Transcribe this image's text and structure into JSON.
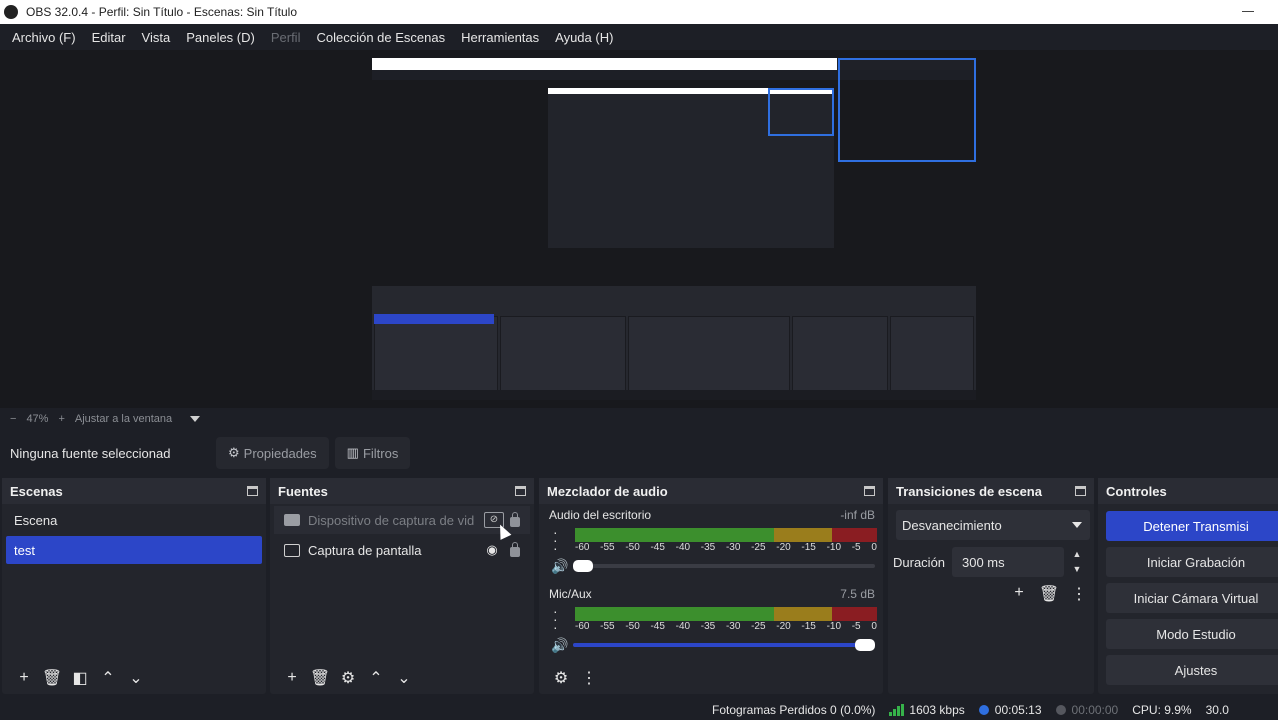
{
  "window": {
    "title": "OBS 32.0.4 - Perfil: Sin Título - Escenas: Sin Título"
  },
  "menu": [
    "Archivo (F)",
    "Editar",
    "Vista",
    "Paneles (D)",
    "Perfil",
    "Colección de Escenas",
    "Herramientas",
    "Ayuda (H)"
  ],
  "zoom": {
    "minus": "−",
    "value": "47%",
    "plus": "+",
    "fit": "Ajustar a la ventana"
  },
  "context": {
    "no_source": "Ninguna fuente seleccionad",
    "properties": "Propiedades",
    "filters": "Filtros"
  },
  "scenes": {
    "title": "Escenas",
    "items": [
      "Escena",
      "test"
    ],
    "selected": "test"
  },
  "sources": {
    "title": "Fuentes",
    "items": [
      "Dispositivo de captura de vid",
      "Captura de pantalla"
    ]
  },
  "mixer": {
    "title": "Mezclador de audio",
    "channels": [
      {
        "name": "Audio del escritorio",
        "db": "-inf dB",
        "volume": 0.0
      },
      {
        "name": "Mic/Aux",
        "db": "7.5 dB",
        "volume": 1.0
      }
    ],
    "ticks": [
      "-60",
      "-55",
      "-50",
      "-45",
      "-40",
      "-35",
      "-30",
      "-25",
      "-20",
      "-15",
      "-10",
      "-5",
      "0"
    ]
  },
  "transitions": {
    "title": "Transiciones de escena",
    "selected": "Desvanecimiento",
    "duration_label": "Duración",
    "duration": "300 ms"
  },
  "controls": {
    "title": "Controles",
    "buttons": [
      "Detener Transmisi",
      "Iniciar Grabación",
      "Iniciar Cámara Virtual",
      "Modo Estudio",
      "Ajustes"
    ]
  },
  "status": {
    "dropped": "Fotogramas Perdidos 0 (0.0%)",
    "bitrate": "1603 kbps",
    "stream_time": "00:05:13",
    "rec_time": "00:00:00",
    "cpu": "CPU: 9.9%",
    "fps": "30.0"
  },
  "colors": {
    "accent": "#2c46c8",
    "live": "#2f6fe0",
    "meter_green": "#3c8f2d",
    "meter_yellow": "#9a7d1c",
    "meter_red": "#8a1d22"
  }
}
